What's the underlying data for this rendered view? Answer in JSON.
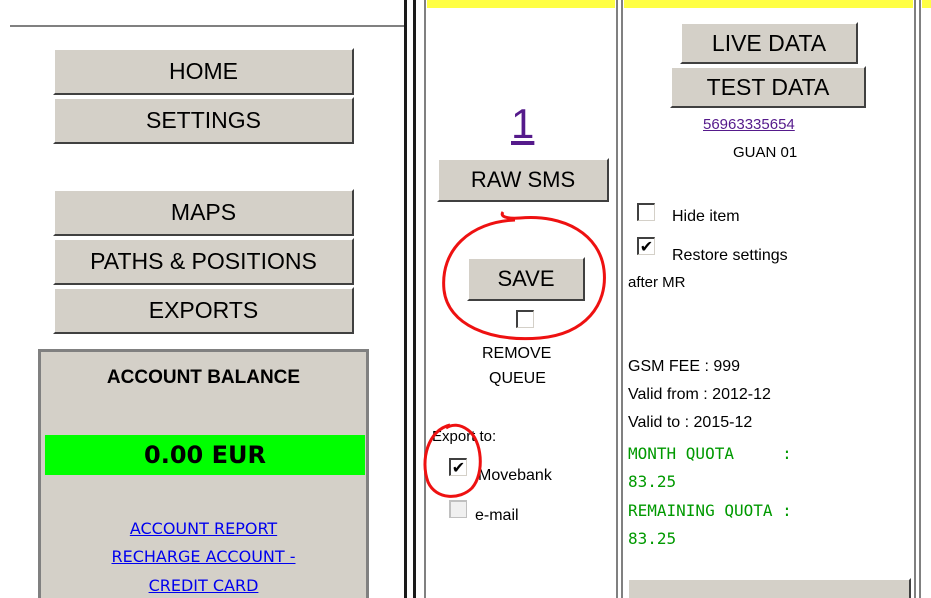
{
  "sidebar": {
    "nav": {
      "home": "HOME",
      "settings": "SETTINGS",
      "maps": "MAPS",
      "paths_positions": "PATHS & POSITIONS",
      "exports": "EXPORTS"
    },
    "balance": {
      "title": "ACCOUNT BALANCE",
      "amount": "0.00 EUR",
      "links": [
        "ACCOUNT REPORT",
        "RECHARGE ACCOUNT -",
        "CREDIT CARD"
      ]
    }
  },
  "middle": {
    "queue_count": "1",
    "raw_sms_label": "RAW SMS",
    "save_label": "SAVE",
    "remove_queue_checked": false,
    "remove_label_line1": "REMOVE",
    "remove_label_line2": "QUEUE",
    "export_to_label": "Export to:",
    "export_options": [
      {
        "label": "Movebank",
        "checked": true
      },
      {
        "label": "e-mail",
        "checked": false
      }
    ]
  },
  "right": {
    "live_data_label": "LIVE DATA",
    "test_data_label": "TEST DATA",
    "phone": "56963335654",
    "device_name": "GUAN 01",
    "hide_item_label": "Hide item",
    "hide_item_checked": false,
    "restore_label": "Restore settings",
    "restore_checked": true,
    "restore_label_line2": "after MR",
    "gsm_fee": "GSM FEE : 999",
    "valid_from": "Valid from : 2012-12",
    "valid_to": "Valid to : 2015-12",
    "month_quota_label": "MONTH QUOTA     :",
    "month_quota_value": "83.25",
    "remaining_quota_label": "REMAINING QUOTA :",
    "remaining_quota_value": "83.25"
  },
  "colors": {
    "button_face": "#d4d0c8",
    "balance_green": "#00ff00",
    "quota_green": "#009900",
    "link_blue": "#0000ee",
    "visited_purple": "#551a8b",
    "annotation_red": "#ee1111",
    "header_yellow": "#ffff44"
  }
}
